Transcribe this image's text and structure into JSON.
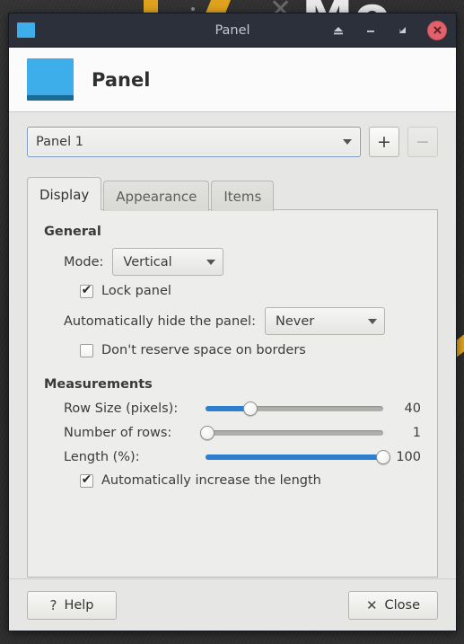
{
  "desktop": {
    "letters": "Mo",
    "x_mark": "✕"
  },
  "window": {
    "titlebar": {
      "title": "Panel",
      "app_icon": "panel-icon",
      "buttons": [
        {
          "name": "shade-button",
          "icon": "eject-icon"
        },
        {
          "name": "minimize-button",
          "icon": "minimize-icon"
        },
        {
          "name": "maximize-button",
          "icon": "maximize-icon"
        },
        {
          "name": "close-button",
          "icon": "close-icon",
          "glyph": "✕",
          "color": "#e2626c"
        }
      ]
    },
    "header": {
      "title": "Panel",
      "icon": "panel-icon"
    }
  },
  "selector": {
    "value": "Panel 1",
    "add_label": "+",
    "remove_label": "−"
  },
  "tabs": [
    {
      "label": "Display",
      "active": true
    },
    {
      "label": "Appearance",
      "active": false
    },
    {
      "label": "Items",
      "active": false
    }
  ],
  "display": {
    "general": {
      "heading": "General",
      "mode_label": "Mode:",
      "mode_value": "Vertical",
      "lock_panel_label": "Lock panel",
      "lock_panel_checked": "✔",
      "autohide_label": "Automatically hide the panel:",
      "autohide_value": "Never",
      "no_reserve_label": "Don't reserve space on borders",
      "no_reserve_checked": ""
    },
    "measurements": {
      "heading": "Measurements",
      "rows": [
        {
          "label": "Row Size (pixels):",
          "value": "40",
          "percent": 25
        },
        {
          "label": "Number of rows:",
          "value": "1",
          "percent": 1
        },
        {
          "label": "Length (%):",
          "value": "100",
          "percent": 100
        }
      ],
      "auto_increase_label": "Automatically increase the length",
      "auto_increase_checked": "✔"
    }
  },
  "footer": {
    "help_glyph": "?",
    "help_label": "Help",
    "close_glyph": "✕",
    "close_label": "Close"
  },
  "colors": {
    "accent": "#3daee9",
    "slider_fill": "#2f7fd1",
    "titlebar": "#2b303b",
    "close_red": "#e2626c"
  }
}
